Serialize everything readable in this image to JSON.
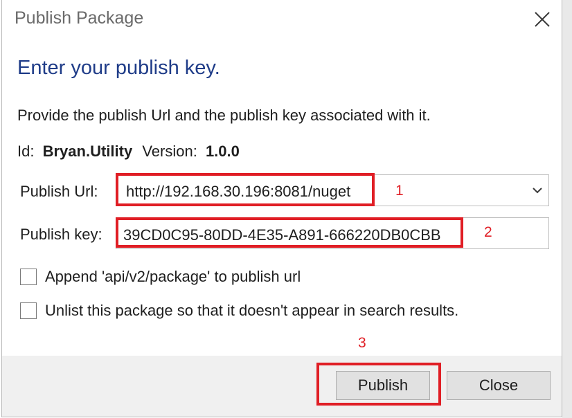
{
  "window": {
    "title": "Publish Package"
  },
  "heading": "Enter your publish key.",
  "description": "Provide the publish Url and the publish key associated with it.",
  "package": {
    "id_label": "Id:",
    "id_value": "Bryan.Utility",
    "version_label": "Version:",
    "version_value": "1.0.0"
  },
  "publish_url": {
    "label": "Publish Url:",
    "value": "http://192.168.30.196:8081/nuget"
  },
  "publish_key": {
    "label": "Publish key:",
    "value": "39CD0C95-80DD-4E35-A891-666220DB0CBB"
  },
  "options": {
    "append": {
      "label": "Append 'api/v2/package' to publish url",
      "checked": false
    },
    "unlist": {
      "label": "Unlist this package so that it doesn't appear in search results.",
      "checked": false
    }
  },
  "buttons": {
    "publish": "Publish",
    "close": "Close"
  },
  "annotations": [
    "1",
    "2",
    "3"
  ],
  "colors": {
    "heading": "#1f3c88",
    "annotation": "#e01e25"
  }
}
